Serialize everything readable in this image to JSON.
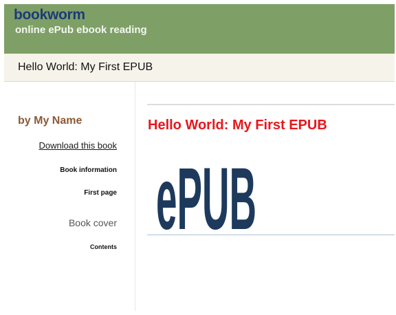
{
  "header": {
    "brand": "bookworm",
    "tagline": "online ePub ebook reading"
  },
  "titlebar": {
    "title": "Hello World: My First EPUB"
  },
  "sidebar": {
    "author": "by My Name",
    "items": [
      {
        "label": "Download this book"
      },
      {
        "label": "Book information"
      },
      {
        "label": "First page"
      },
      {
        "label": "Book cover"
      },
      {
        "label": "Contents"
      }
    ]
  },
  "main": {
    "book_title": "Hello World: My First EPUB",
    "logo_text": "ePUB"
  },
  "colors": {
    "header_bg": "#7ea067",
    "brand": "#1d3a78",
    "title_red": "#e8161b",
    "author_brown": "#8a5a36",
    "logo_navy": "#1d3a5c"
  }
}
